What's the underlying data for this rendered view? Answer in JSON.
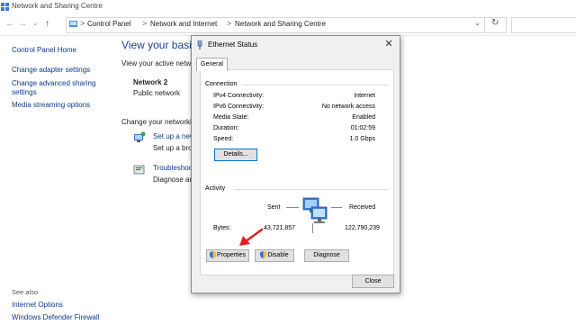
{
  "window": {
    "title": "Network and Sharing Centre"
  },
  "address": {
    "crumbs": [
      "Control Panel",
      "Network and Internet",
      "Network and Sharing Centre"
    ],
    "separator": ">"
  },
  "left_pane": {
    "home": "Control Panel Home",
    "links": [
      "Change adapter settings",
      "Change advanced sharing",
      "settings",
      "Media streaming options"
    ],
    "see_also": "See also",
    "see_also_links": [
      "Internet Options",
      "Windows Defender Firewall"
    ]
  },
  "main": {
    "heading": "View your basic ne",
    "active_networks": "View your active netwo",
    "network_name": "Network 2",
    "network_type": "Public network",
    "change_settings": "Change your networkin",
    "setup_link": "Set up a new",
    "setup_desc": "Set up a broa",
    "troubleshoot_link": "Troubleshoot",
    "troubleshoot_desc": "Diagnose and"
  },
  "dialog": {
    "title": "Ethernet Status",
    "close_glyph": "✕",
    "tab": "General",
    "connection": {
      "heading": "Connection",
      "rows": [
        {
          "label": "IPv4 Connectivity:",
          "value": "Internet"
        },
        {
          "label": "IPv6 Connectivity:",
          "value": "No network access"
        },
        {
          "label": "Media State:",
          "value": "Enabled"
        },
        {
          "label": "Duration:",
          "value": "01:02:59"
        },
        {
          "label": "Speed:",
          "value": "1.0 Gbps"
        }
      ],
      "details_button": "Details..."
    },
    "activity": {
      "heading": "Activity",
      "sent_label": "Sent",
      "received_label": "Received",
      "bytes_label": "Bytes:",
      "bytes_sent": "43,721,857",
      "bytes_received": "122,790,239"
    },
    "buttons": {
      "properties": "Properties",
      "disable": "Disable",
      "diagnose": "Diagnose"
    },
    "close_button": "Close"
  },
  "colors": {
    "link": "#0a3a8c",
    "heading": "#1e3f9a",
    "annotation_arrow": "#e02020"
  }
}
